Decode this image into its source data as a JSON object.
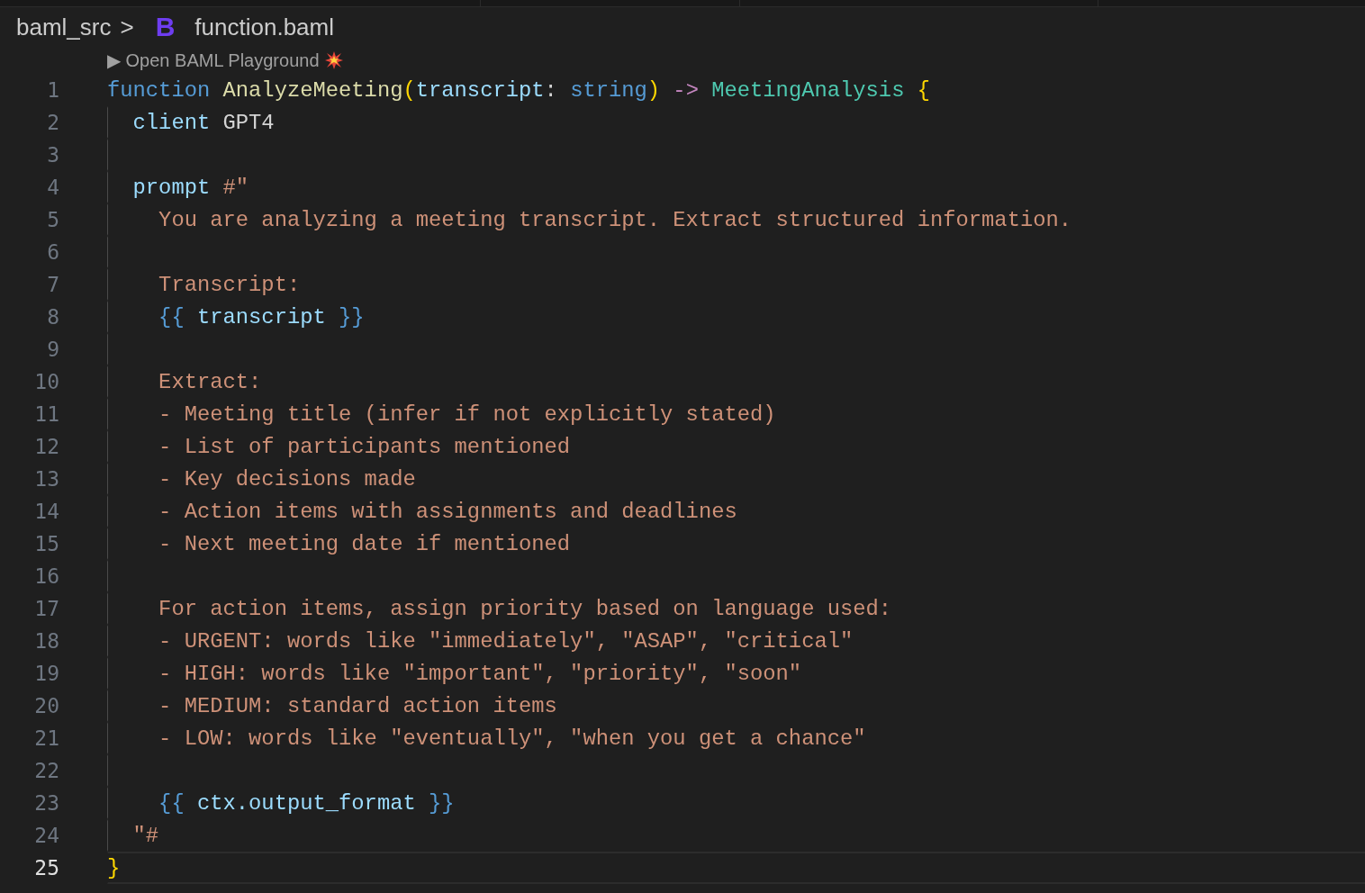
{
  "breadcrumb": {
    "folder": "baml_src",
    "separator": ">",
    "file_icon": "B",
    "file": "function.baml"
  },
  "codelens": {
    "label": "▶ Open BAML Playground"
  },
  "lines": [
    {
      "number": "1",
      "current": false,
      "guide": false,
      "tokens": [
        {
          "kind": "keyword",
          "text": "function "
        },
        {
          "kind": "function",
          "text": "AnalyzeMeeting"
        },
        {
          "kind": "paren",
          "text": "("
        },
        {
          "kind": "param",
          "text": "transcript"
        },
        {
          "kind": "punct",
          "text": ": "
        },
        {
          "kind": "type",
          "text": "string"
        },
        {
          "kind": "paren",
          "text": ")"
        },
        {
          "kind": "arrow",
          "text": " -> "
        },
        {
          "kind": "class",
          "text": "MeetingAnalysis "
        },
        {
          "kind": "paren",
          "text": "{"
        }
      ]
    },
    {
      "number": "2",
      "current": false,
      "guide": true,
      "tokens": [
        {
          "kind": "param",
          "text": "  client "
        },
        {
          "kind": "plain",
          "text": "GPT4"
        }
      ]
    },
    {
      "number": "3",
      "current": false,
      "guide": true
    },
    {
      "number": "4",
      "current": false,
      "guide": true,
      "tokens": [
        {
          "kind": "param",
          "text": "  prompt "
        },
        {
          "kind": "string",
          "text": "#\""
        }
      ]
    },
    {
      "number": "5",
      "current": false,
      "guide": true,
      "tokens": [
        {
          "kind": "string",
          "text": "    You are analyzing a meeting transcript. Extract structured information."
        }
      ]
    },
    {
      "number": "6",
      "current": false,
      "guide": true
    },
    {
      "number": "7",
      "current": false,
      "guide": true,
      "tokens": [
        {
          "kind": "string",
          "text": "    Transcript:"
        }
      ]
    },
    {
      "number": "8",
      "current": false,
      "guide": true,
      "tokens": [
        {
          "kind": "interp",
          "text": "    {{ "
        },
        {
          "kind": "param",
          "text": "transcript"
        },
        {
          "kind": "interp",
          "text": " }}"
        }
      ]
    },
    {
      "number": "9",
      "current": false,
      "guide": true
    },
    {
      "number": "10",
      "current": false,
      "guide": true,
      "tokens": [
        {
          "kind": "string",
          "text": "    Extract:"
        }
      ]
    },
    {
      "number": "11",
      "current": false,
      "guide": true,
      "tokens": [
        {
          "kind": "string",
          "text": "    - Meeting title (infer if not explicitly stated)"
        }
      ]
    },
    {
      "number": "12",
      "current": false,
      "guide": true,
      "tokens": [
        {
          "kind": "string",
          "text": "    - List of participants mentioned"
        }
      ]
    },
    {
      "number": "13",
      "current": false,
      "guide": true,
      "tokens": [
        {
          "kind": "string",
          "text": "    - Key decisions made"
        }
      ]
    },
    {
      "number": "14",
      "current": false,
      "guide": true,
      "tokens": [
        {
          "kind": "string",
          "text": "    - Action items with assignments and deadlines"
        }
      ]
    },
    {
      "number": "15",
      "current": false,
      "guide": true,
      "tokens": [
        {
          "kind": "string",
          "text": "    - Next meeting date if mentioned"
        }
      ]
    },
    {
      "number": "16",
      "current": false,
      "guide": true
    },
    {
      "number": "17",
      "current": false,
      "guide": true,
      "tokens": [
        {
          "kind": "string",
          "text": "    For action items, assign priority based on language used:"
        }
      ]
    },
    {
      "number": "18",
      "current": false,
      "guide": true,
      "tokens": [
        {
          "kind": "string",
          "text": "    - URGENT: words like \"immediately\", \"ASAP\", \"critical\""
        }
      ]
    },
    {
      "number": "19",
      "current": false,
      "guide": true,
      "tokens": [
        {
          "kind": "string",
          "text": "    - HIGH: words like \"important\", \"priority\", \"soon\""
        }
      ]
    },
    {
      "number": "20",
      "current": false,
      "guide": true,
      "tokens": [
        {
          "kind": "string",
          "text": "    - MEDIUM: standard action items"
        }
      ]
    },
    {
      "number": "21",
      "current": false,
      "guide": true,
      "tokens": [
        {
          "kind": "string",
          "text": "    - LOW: words like \"eventually\", \"when you get a chance\""
        }
      ]
    },
    {
      "number": "22",
      "current": false,
      "guide": true
    },
    {
      "number": "23",
      "current": false,
      "guide": true,
      "tokens": [
        {
          "kind": "interp",
          "text": "    {{ "
        },
        {
          "kind": "param",
          "text": "ctx.output_format"
        },
        {
          "kind": "interp",
          "text": " }}"
        }
      ]
    },
    {
      "number": "24",
      "current": false,
      "guide": true,
      "tokens": [
        {
          "kind": "string",
          "text": "  \"#"
        }
      ]
    },
    {
      "number": "25",
      "current": true,
      "guide": false,
      "tokens": [
        {
          "kind": "paren",
          "text": "}"
        }
      ]
    }
  ]
}
